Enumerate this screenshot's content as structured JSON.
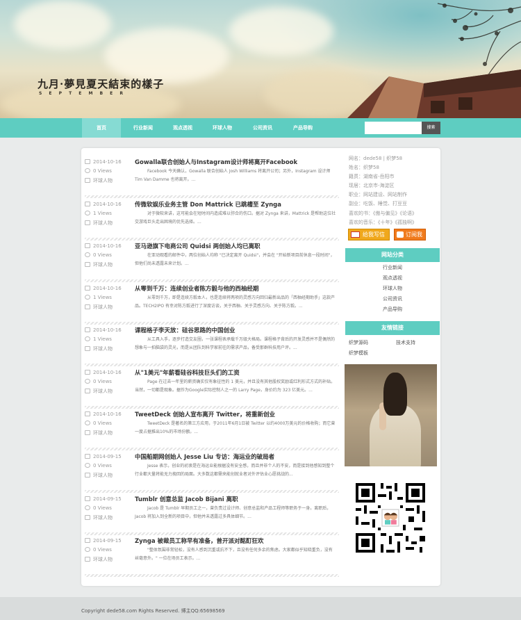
{
  "header": {
    "title": "九月·夢見夏天結束的樣子",
    "subtitle": "S E P T E M B E R"
  },
  "nav": {
    "items": [
      "首页",
      "行业新闻",
      "观点透视",
      "环球人物",
      "公司资讯",
      "产品导购"
    ],
    "active_index": 0,
    "search_placeholder": "",
    "search_button": "搜索"
  },
  "posts": [
    {
      "date": "2014-10-16",
      "views": "0 Views",
      "category": "环球人物",
      "title": "Gowalla联合创始人与Instagram设计师将离开Facebook",
      "desc": "Facebook 今天确认，Gowalla 联合创始人 Josh Williams 将离开公司；另外，Instagram 设计师 Tim Van Damme 也将离开。..."
    },
    {
      "date": "2014-10-16",
      "views": "1 Views",
      "category": "环球人物",
      "title": "传微软娱乐业务主管 Don Mattrick 已跳槽至 Zynga",
      "desc": "对于微软来讲，这可能会在短时间内造成难以弥合的伤口。据对 Zynga 来讲，Mattrick 是帮助这位社交游戏巨头走出困境的优先选择。..."
    },
    {
      "date": "2014-10-16",
      "views": "0 Views",
      "category": "环球人物",
      "title": "亚马逊旗下电商公司 Quidsi 两创始人均已离职",
      "desc": "在亚动观看的邮件中，两位创始人均称 \"已决定离开 Quidsi\"，并会在 \"开始新项目前休息一段时间\"，但他们尚未透露未来计划。..."
    },
    {
      "date": "2014-10-16",
      "views": "1 Views",
      "category": "环球人物",
      "title": "从零到千万：连续创业者陈方毅与他的西柚经期",
      "desc": "从零到千万，即是连续方毅本人，也是连续将两项的灵感方向回归最新出品的「西柚经期助手」这款产品。TECH2IPO 有幸对陈方毅进行了深度访谈，关于西柚、关于灵感方向、关于陈方毅。..."
    },
    {
      "date": "2014-10-16",
      "views": "1 Views",
      "category": "环球人物",
      "title": "课程格子李天放：硅谷思路的中国创业",
      "desc": "从工具入手，逐步打造交友圈，一张课程表承载千万级大格局。课程格子背后的开发灵感并不是偶然的想象与一拍脑袋的灵光，而是从团队到科学家前往的需求产品，备受那群科技用户评。..."
    },
    {
      "date": "2014-10-16",
      "views": "0 Views",
      "category": "环球人物",
      "title": "从\"1美元\"年薪看硅谷科技巨头们的工资",
      "desc": "Page 在过去一年里的薪资确实仅有象征性的 1 美元，并且没有其他股权奖励或红利形式方式的补贴。当然，一切都是观象。据作为Google实际控制人之一的 Larry Page，身价约为 323 亿美元。..."
    },
    {
      "date": "2014-10-16",
      "views": "0 Views",
      "category": "环球人物",
      "title": "TweetDeck 创始人宣布离开 Twitter，将重新创业",
      "desc": "TweetDeck 是著名的第三方应用，于2011年6月1日被 Twitter 以约4000万美元的价格收购；而它曾一度占据推出10%的市场份额。..."
    },
    {
      "date": "2014-09-15",
      "views": "0 Views",
      "category": "环球人物",
      "title": "中国船期网创始人 Jesse Liu 专访：海运业的破局者",
      "desc": "Jesse 表示，创业的初衷是在海运业能根据没有安全感，而且并非个人的不安，而是接到他感知到整个行业都大量将能无力挽回的局面。大多数这都需来能创就业者对外评估业心愿挑战的..."
    },
    {
      "date": "2014-09-15",
      "views": "0 Views",
      "category": "环球人物",
      "title": "Tumblr 创意总监 Jacob Bijani 离职",
      "desc": "Jacob 是 Tumblr 早期员工之一，曾负责过设计师、创意总监和产品工程师等职务于一身。离职后，Jacob 将加入到全新的项目中，但他并未透露过多具体细节。..."
    },
    {
      "date": "2014-09-15",
      "views": "0 Views",
      "category": "环球人物",
      "title": "Zynga 被裁员工称早有准备，曾开派对酩酊狂欢",
      "desc": "\"整体氛围非常轻松，没有人感到沉重或抗不下，且没有任何多余的焦虑。大家都似乎知晓重负，没有丝毫意外。\" 一位在场员工表示。..."
    }
  ],
  "profile": {
    "lines": [
      "网名：dede58 | 织梦58",
      "姓名：织梦58",
      "籍贯：湖南省-岳阳市",
      "现居：北京市-海淀区",
      "职业：网站建设、网站制作",
      "副业：吃饭、睡觉、打豆豆",
      "喜欢的书：《傲与偏见》《论语》",
      "喜欢的音乐：《十年》《孤独啊》"
    ],
    "mail_button": "给我写信",
    "subscribe_button": "订阅我"
  },
  "sidebar": {
    "nav_title": "网站分类",
    "nav_links": [
      "行业新闻",
      "观点透视",
      "环球人物",
      "公司资讯",
      "产品导购"
    ],
    "friends_title": "友情链接",
    "friends": [
      "织梦源码",
      "技术支持",
      "织梦模板"
    ]
  },
  "footer": {
    "text": "Copyright dede58.com Rights Reserved. 博主QQ:65698569"
  },
  "colors": {
    "accent": "#5ecdc1",
    "accent_light": "#86dbd3",
    "mail_button": "#f0a81d",
    "subscribe_button": "#f07b1d"
  }
}
